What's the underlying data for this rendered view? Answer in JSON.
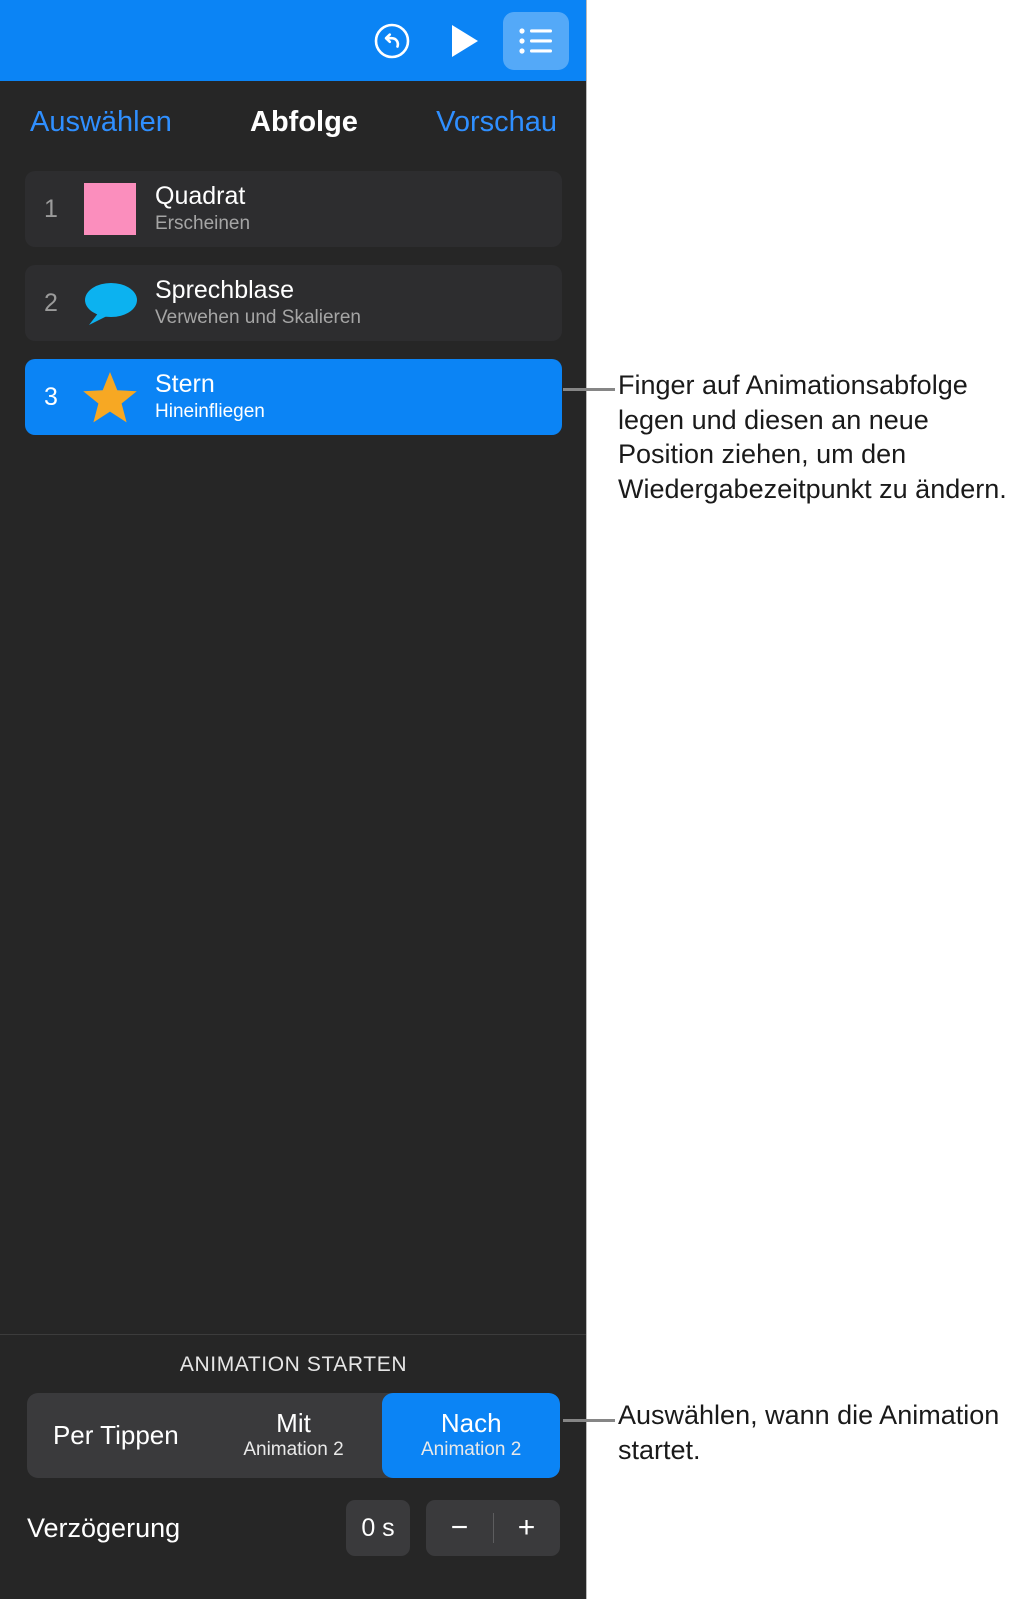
{
  "toolbar": {
    "undo_icon": "undo-circle-icon",
    "play_icon": "play-icon",
    "list_icon": "animation-list-icon"
  },
  "panel_header": {
    "left_label": "Auswählen",
    "title": "Abfolge",
    "right_label": "Vorschau"
  },
  "build_list": {
    "items": [
      {
        "index": "1",
        "title": "Quadrat",
        "effect": "Erscheinen",
        "icon": "pink-square-icon",
        "icon_color": "#fb8ebd",
        "selected": false
      },
      {
        "index": "2",
        "title": "Sprechblase",
        "effect": "Verwehen und Skalieren",
        "icon": "speech-bubble-icon",
        "icon_color": "#0cb2f0",
        "selected": false
      },
      {
        "index": "3",
        "title": "Stern",
        "effect": "Hineinfliegen",
        "icon": "star-icon",
        "icon_color": "#f7a823",
        "selected": true
      }
    ]
  },
  "start_animation": {
    "section_title": "ANIMATION STARTEN",
    "options": [
      {
        "main": "Per Tippen",
        "sub": "",
        "selected": false
      },
      {
        "main": "Mit",
        "sub": "Animation 2",
        "selected": false
      },
      {
        "main": "Nach",
        "sub": "Animation 2",
        "selected": true
      }
    ],
    "delay_label": "Verzögerung",
    "delay_value": "0 s",
    "decrement_label": "−",
    "increment_label": "+"
  },
  "callouts": {
    "drag_reorder": "Finger auf Animationsabfolge legen und diesen an neue Position ziehen, um den Wiedergabezeitpunkt zu ändern.",
    "start_timing": "Auswählen, wann die Animation startet."
  },
  "colors": {
    "accent_blue": "#0b84f5",
    "panel_bg": "#262626",
    "card_bg": "#2d2d2f",
    "control_bg": "#3a3a3c",
    "link_blue": "#2f8fff"
  }
}
